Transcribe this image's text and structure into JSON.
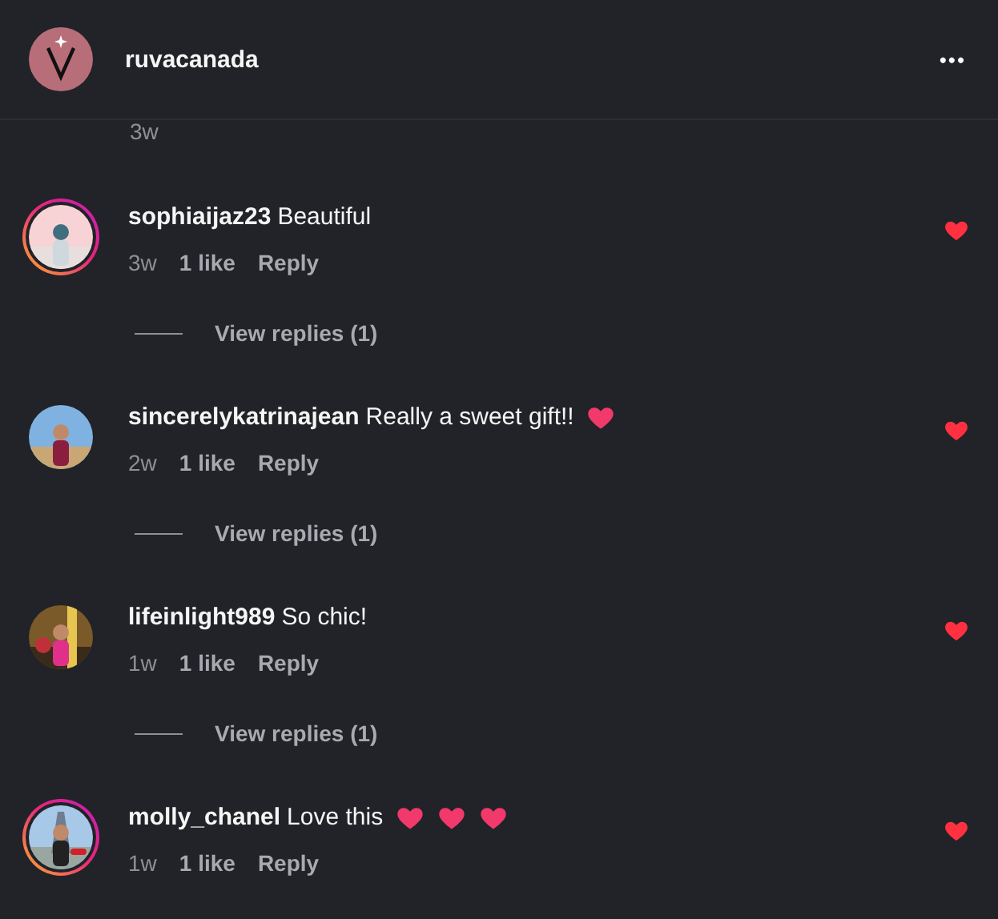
{
  "header": {
    "username": "ruvacanada",
    "more": "•••"
  },
  "caption_time": "3w",
  "comments": [
    {
      "username": "sophiaijaz23",
      "text": "Beautiful",
      "story_ring": true,
      "avatar": {
        "kind": "picture"
      },
      "time": "3w",
      "likes": "1 like",
      "reply": "Reply",
      "view_replies": "View replies (1)",
      "liked": true
    },
    {
      "username": "sincerelykatrinajean",
      "text": "Really a sweet gift!!",
      "emojis": [
        {
          "kind": "heart"
        }
      ],
      "story_ring": false,
      "avatar": {
        "kind": "picture"
      },
      "time": "2w",
      "likes": "1 like",
      "reply": "Reply",
      "view_replies": "View replies (1)",
      "liked": true
    },
    {
      "username": "lifeinlight989",
      "text": "So chic!",
      "story_ring": false,
      "avatar": {
        "kind": "picture"
      },
      "time": "1w",
      "likes": "1 like",
      "reply": "Reply",
      "view_replies": "View replies (1)",
      "liked": true
    },
    {
      "username": "molly_chanel",
      "text": "Love this",
      "emojis": [
        {
          "kind": "heart"
        },
        {
          "kind": "heart"
        },
        {
          "kind": "heart"
        }
      ],
      "story_ring": true,
      "avatar": {
        "kind": "picture"
      },
      "time": "1w",
      "likes": "1 like",
      "reply": "Reply",
      "liked": true
    }
  ]
}
